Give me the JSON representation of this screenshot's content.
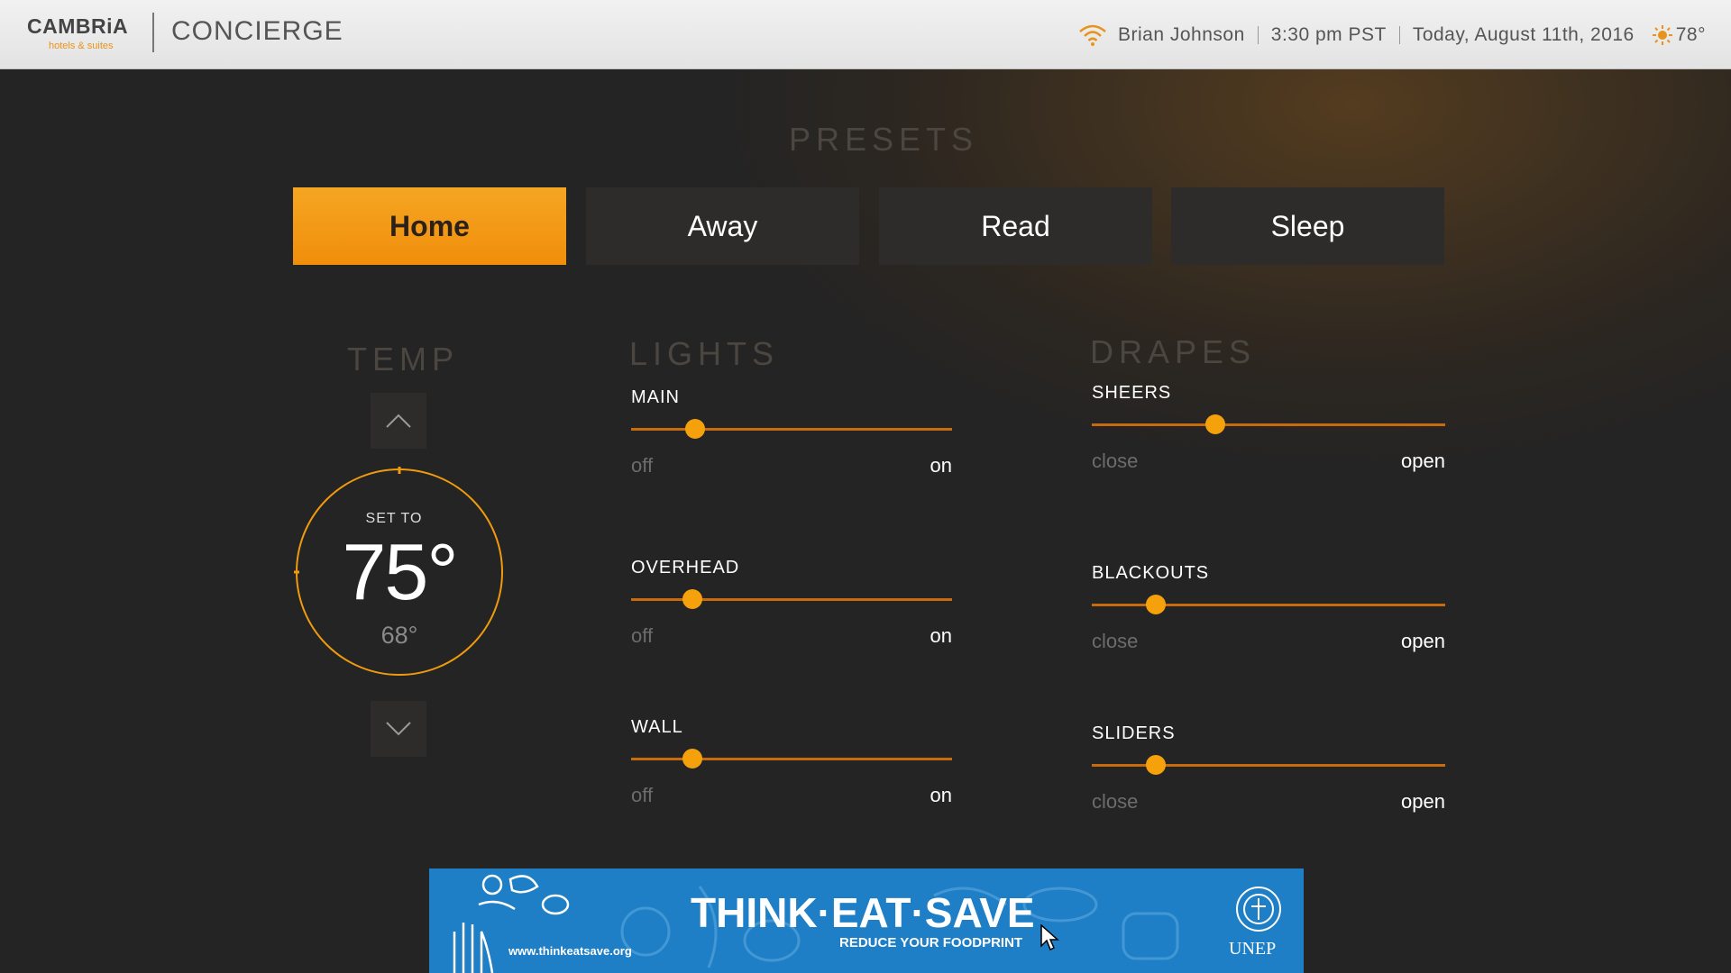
{
  "header": {
    "logo_name": "CAMBRiA",
    "logo_sub": "hotels & suites",
    "app_title": "CONCIERGE",
    "user": "Brian Johnson",
    "time": "3:30 pm PST",
    "date": "Today, August 11th, 2016",
    "weather_temp": "78°",
    "icons": {
      "wifi": "wifi-icon",
      "weather": "sun-icon"
    }
  },
  "presets": {
    "title": "PRESETS",
    "items": [
      {
        "label": "Home",
        "active": true
      },
      {
        "label": "Away",
        "active": false
      },
      {
        "label": "Read",
        "active": false
      },
      {
        "label": "Sleep",
        "active": false
      }
    ]
  },
  "temp": {
    "title": "TEMP",
    "set_label": "SET TO",
    "set_value": "75°",
    "current_value": "68°"
  },
  "lights": {
    "title": "LIGHTS",
    "min_label": "off",
    "max_label": "on",
    "items": [
      {
        "label": "MAIN",
        "level": 0.2
      },
      {
        "label": "OVERHEAD",
        "level": 0.19
      },
      {
        "label": "WALL",
        "level": 0.19
      }
    ]
  },
  "drapes": {
    "title": "DRAPES",
    "min_label": "close",
    "max_label": "open",
    "items": [
      {
        "label": "SHEERS",
        "level": 0.35
      },
      {
        "label": "BLACKOUTS",
        "level": 0.18
      },
      {
        "label": "SLIDERS",
        "level": 0.18
      }
    ]
  },
  "banner": {
    "title": "THINK·EAT·SAVE",
    "subtitle": "REDUCE YOUR FOODPRINT",
    "url": "www.thinkeatsave.org",
    "org": "UNEP"
  },
  "colors": {
    "accent": "#f5a10c",
    "track": "#c96a0d",
    "panel": "#2e2c2a",
    "banner": "#1f7fc6"
  }
}
